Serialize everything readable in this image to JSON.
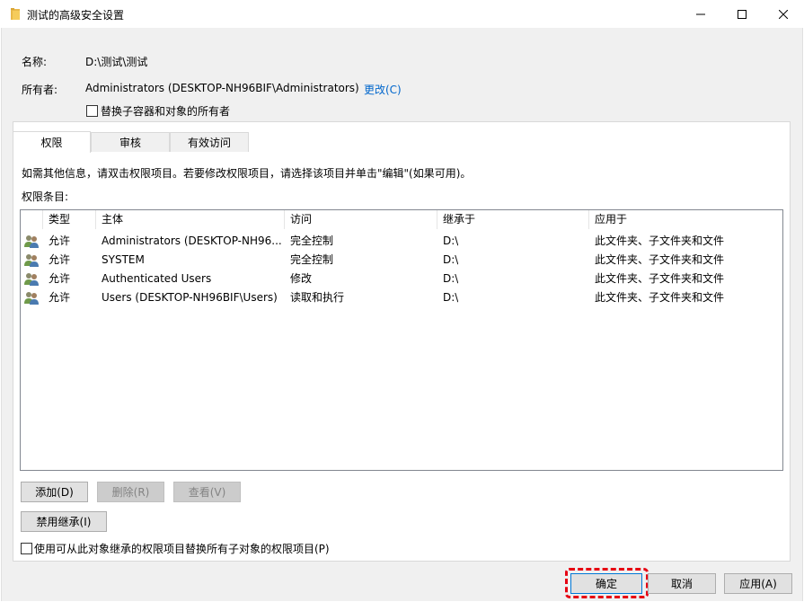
{
  "window": {
    "title": "测试的高级安全设置"
  },
  "info": {
    "name_label": "名称:",
    "name_value": "D:\\测试\\测试",
    "owner_label": "所有者:",
    "owner_value": "Administrators (DESKTOP-NH96BIF\\Administrators)",
    "owner_change_link": "更改(C)",
    "replace_owner_label": "替换子容器和对象的所有者"
  },
  "tabs": [
    {
      "label": "权限"
    },
    {
      "label": "审核"
    },
    {
      "label": "有效访问"
    }
  ],
  "permissions": {
    "help_text": "如需其他信息，请双击权限项目。若要修改权限项目，请选择该项目并单击\"编辑\"(如果可用)。",
    "entries_label": "权限条目:",
    "columns": [
      "类型",
      "主体",
      "访问",
      "继承于",
      "应用于"
    ],
    "rows": [
      {
        "type": "允许",
        "principal": "Administrators (DESKTOP-NH96...",
        "access": "完全控制",
        "inherited_from": "D:\\",
        "applies_to": "此文件夹、子文件夹和文件"
      },
      {
        "type": "允许",
        "principal": "SYSTEM",
        "access": "完全控制",
        "inherited_from": "D:\\",
        "applies_to": "此文件夹、子文件夹和文件"
      },
      {
        "type": "允许",
        "principal": "Authenticated Users",
        "access": "修改",
        "inherited_from": "D:\\",
        "applies_to": "此文件夹、子文件夹和文件"
      },
      {
        "type": "允许",
        "principal": "Users (DESKTOP-NH96BIF\\Users)",
        "access": "读取和执行",
        "inherited_from": "D:\\",
        "applies_to": "此文件夹、子文件夹和文件"
      }
    ],
    "add_button": "添加(D)",
    "remove_button": "删除(R)",
    "view_button": "查看(V)",
    "disable_inheritance_button": "禁用继承(I)",
    "replace_child_label": "使用可从此对象继承的权限项目替换所有子对象的权限项目(P)"
  },
  "footer": {
    "ok_button": "确定",
    "cancel_button": "取消",
    "apply_button": "应用(A)"
  },
  "colors": {
    "link": "#0066cc",
    "highlight": "#e60012",
    "dialog_bg": "#f0f0f0"
  }
}
